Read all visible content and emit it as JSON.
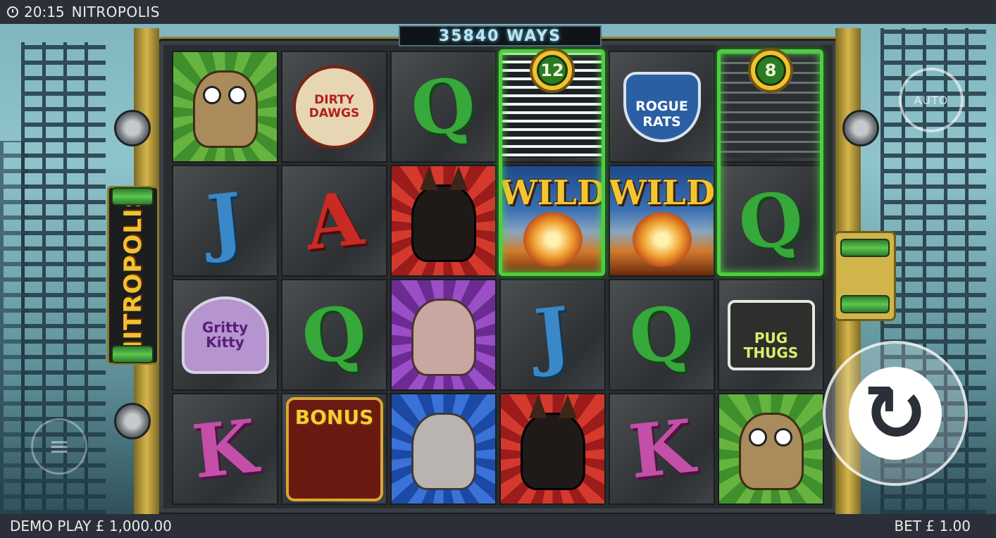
{
  "status_bar": {
    "time": "20:15",
    "title": "NITROPOLIS"
  },
  "ways_display": "35840 WAYS",
  "logo": "NITROPOLIS",
  "nitro_counters": [
    "12",
    "8"
  ],
  "reels": [
    [
      {
        "kind": "char",
        "name": "pug",
        "bg": "green"
      },
      {
        "kind": "letter",
        "value": "J",
        "color": "j"
      },
      {
        "kind": "badge",
        "value": "Gritty Kitty",
        "style": "kitty"
      },
      {
        "kind": "letter",
        "value": "K",
        "color": "k"
      }
    ],
    [
      {
        "kind": "badge",
        "value": "DIRTY DAWGS",
        "style": "dawgs"
      },
      {
        "kind": "letter",
        "value": "A",
        "color": "a"
      },
      {
        "kind": "letter",
        "value": "Q",
        "color": "q"
      },
      {
        "kind": "badge",
        "value": "BONUS",
        "style": "bonus"
      }
    ],
    [
      {
        "kind": "letter",
        "value": "Q",
        "color": "q"
      },
      {
        "kind": "char",
        "name": "doberman",
        "bg": "red"
      },
      {
        "kind": "char",
        "name": "cat",
        "bg": "purple"
      },
      {
        "kind": "char",
        "name": "rat",
        "bg": "blue"
      }
    ],
    [
      {
        "kind": "nitro-bar"
      },
      {
        "kind": "wild",
        "value": "WILD"
      },
      {
        "kind": "letter",
        "value": "J",
        "color": "j"
      },
      {
        "kind": "char",
        "name": "doberman",
        "bg": "red"
      }
    ],
    [
      {
        "kind": "badge",
        "value": "ROGUE RATS",
        "style": "rats"
      },
      {
        "kind": "wild",
        "value": "WILD"
      },
      {
        "kind": "letter",
        "value": "Q",
        "color": "q"
      },
      {
        "kind": "letter",
        "value": "K",
        "color": "k"
      }
    ],
    [
      {
        "kind": "nitro-bar-dim"
      },
      {
        "kind": "letter",
        "value": "Q",
        "color": "q"
      },
      {
        "kind": "badge",
        "value": "PUG THUGS",
        "style": "thugs"
      },
      {
        "kind": "char",
        "name": "pug",
        "bg": "green"
      }
    ]
  ],
  "auto_button": "AUTO",
  "balance": {
    "label": "DEMO PLAY £ 1,000.00"
  },
  "bet": {
    "label": "BET £ 1.00"
  },
  "colors": {
    "nitro_green": "#4bd03e",
    "frame_gold": "#d6b44a",
    "bar_bg": "#2a2f38"
  }
}
